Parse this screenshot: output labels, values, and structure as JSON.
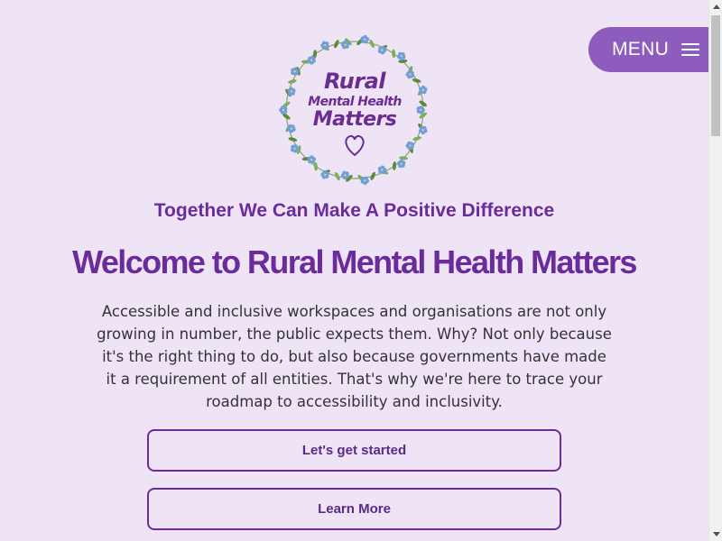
{
  "header": {
    "menu_label": "MENU"
  },
  "logo": {
    "line1": "Rural",
    "line2": "Mental Health",
    "line3": "Matters",
    "colors": {
      "text": "#6a2c91",
      "leaf": "#5d8a3e",
      "flower": "#6f9fdc",
      "flower_center": "#f2d86b"
    }
  },
  "hero": {
    "tagline": "Together We Can Make A Positive Difference",
    "title": "Welcome to Rural Mental Health Matters",
    "intro": "Accessible and inclusive workspaces and organisations are not only growing in number, the public expects them. Why? Not only because it's the right thing to do, but also because governments have made it a requirement of all entities. That's why we're here to trace your roadmap to accessibility and inclusivity."
  },
  "actions": {
    "get_started": "Let's get started",
    "learn_more": "Learn More"
  },
  "theme": {
    "background": "#efe3f6",
    "accent": "#6a2c9a",
    "menu_bg": "#8e5cbc"
  }
}
